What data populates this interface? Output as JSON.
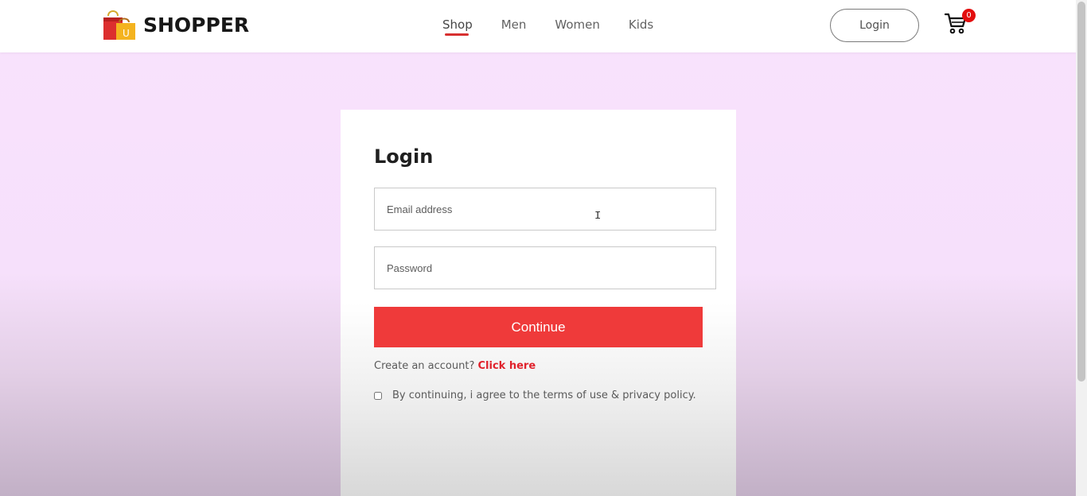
{
  "header": {
    "brand": "SHOPPER",
    "bag_letter": "U",
    "nav": [
      {
        "label": "Shop",
        "active": true
      },
      {
        "label": "Men",
        "active": false
      },
      {
        "label": "Women",
        "active": false
      },
      {
        "label": "Kids",
        "active": false
      }
    ],
    "login_label": "Login",
    "cart_count": "0"
  },
  "login_form": {
    "title": "Login",
    "email_placeholder": "Email address",
    "password_placeholder": "Password",
    "continue_label": "Continue",
    "signup_prompt": "Create an account?",
    "signup_link": "Click here",
    "agree_text": "By continuing, i agree to the terms of use & privacy policy.",
    "agree_checked": false
  },
  "colors": {
    "accent": "#ef3a3a",
    "nav_underline": "#d72f2f",
    "badge": "#e30e0e",
    "background": "#f9e2fd"
  },
  "icons": {
    "logo": "shopping-bag-icon",
    "cart": "cart-icon"
  }
}
